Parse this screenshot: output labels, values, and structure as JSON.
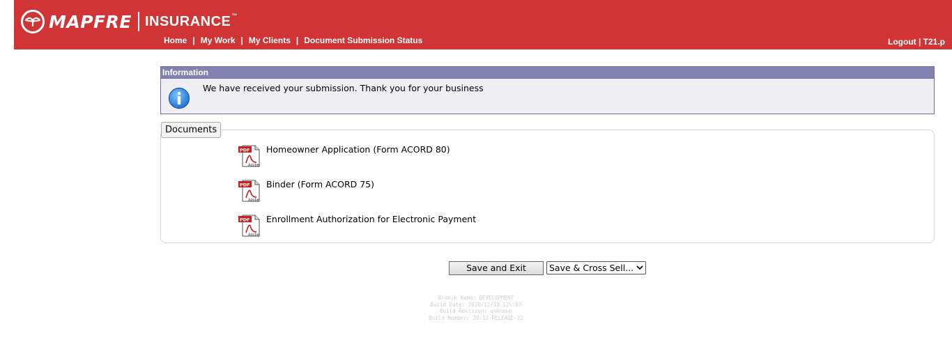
{
  "header": {
    "brand": "MAPFRE",
    "product": "INSURANCE",
    "trademark": "™",
    "nav": [
      {
        "label": "Home"
      },
      {
        "label": "My Work"
      },
      {
        "label": "My Clients"
      },
      {
        "label": "Document Submission Status"
      }
    ],
    "nav_separator": "|",
    "logout": "Logout | T21.p",
    "colors": {
      "brand_red": "#d03434"
    }
  },
  "info": {
    "title": "Information",
    "message": "We have received your submission. Thank you for your business",
    "icon": "info-icon"
  },
  "documents": {
    "legend": "Documents",
    "items": [
      {
        "label": "Homeowner Application (Form ACORD 80)",
        "icon": "pdf-icon"
      },
      {
        "label": "Binder (Form ACORD 75)",
        "icon": "pdf-icon"
      },
      {
        "label": "Enrollment Authorization for Electronic Payment",
        "icon": "pdf-icon"
      }
    ]
  },
  "actions": {
    "save_exit": "Save and Exit",
    "cross_sell_selected": "Save & Cross Sell..."
  },
  "build": {
    "branch": "Branch Name: DEVELOPMENT",
    "date": "Build Date: 2020/12/10 12\\:07",
    "revision": "Build Revision: unknown",
    "number": "Build Number: 20.12-RELEASE-32"
  }
}
